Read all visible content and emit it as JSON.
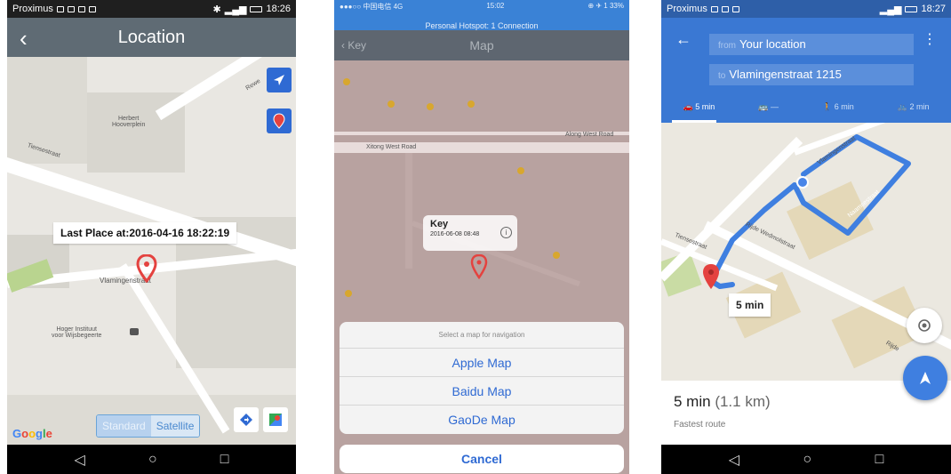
{
  "screen1": {
    "status_left": "Proximus",
    "status_time": "18:26",
    "title": "Location",
    "callout_text": "Last Place at:2016-04-16 18:22:19",
    "labels": {
      "herbert": "Herbert\nHooverplein",
      "tiensestraat": "Tiensestraat",
      "vlamingenstraat": "Vlamingenstraat",
      "hoger": "Hoger Instituut\nvoor Wijsbegeerte",
      "rewe": "Rewe"
    },
    "map_type": {
      "standard": "Standard",
      "satellite": "Satellite"
    },
    "google_logo": "Google",
    "colors": {
      "appbar": "#5f6b74",
      "accent": "#2f6ad3",
      "pin": "#e4423f"
    }
  },
  "screen2": {
    "status_left": "●●●○○ 中国电信 4G",
    "status_time": "15:02",
    "status_right": "⊕ ✈ 1 33%",
    "hotspot": "Personal Hotspot: 1 Connection",
    "back_label": "Key",
    "title": "Map",
    "road_label": "Xitong West Road",
    "road_label2": "Along West Road",
    "callout_name": "Key",
    "callout_time": "2016-06-08 08:48",
    "sheet_header": "Select a map for navigation",
    "options": [
      "Apple Map",
      "Baidu Map",
      "GaoDe Map"
    ],
    "cancel": "Cancel"
  },
  "screen3": {
    "status_left": "Proximus",
    "status_time": "18:27",
    "from_prefix": "from",
    "from_value": "Your location",
    "to_prefix": "to",
    "to_value": "Vlamingenstraat 1215",
    "modes": [
      "5 min",
      "—",
      "6 min",
      "2 min"
    ],
    "route_label": "5 min",
    "street_labels": [
      "Tiensestraat",
      "Rijde Wedmolstraat",
      "Vlamingenstraat",
      "Naamsestraat",
      "Rijde"
    ],
    "summary_time": "5 min",
    "summary_dist": "(1.1 km)",
    "summary_sub": "Fastest route",
    "colors": {
      "route": "#4a86e8",
      "header": "#3a78d3"
    }
  }
}
